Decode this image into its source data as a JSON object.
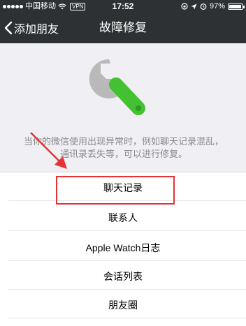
{
  "status_bar": {
    "carrier": "中国移动",
    "vpn": "VPN",
    "time": "17:52",
    "battery": "97%"
  },
  "nav": {
    "back_label": "添加朋友",
    "title": "故障修复"
  },
  "description": "当你的微信使用出现异常时，例如聊天记录混乱，通讯录丢失等，可以进行修复。",
  "list": {
    "items": [
      {
        "label": "聊天记录"
      },
      {
        "label": "联系人"
      },
      {
        "label": "Apple Watch日志"
      },
      {
        "label": "会话列表"
      },
      {
        "label": "朋友圈"
      }
    ]
  },
  "colors": {
    "nav_bg": "#2e3133",
    "wrench_gray": "#b9b9b9",
    "handle_green": "#43c132",
    "highlight_red": "#e63234"
  }
}
